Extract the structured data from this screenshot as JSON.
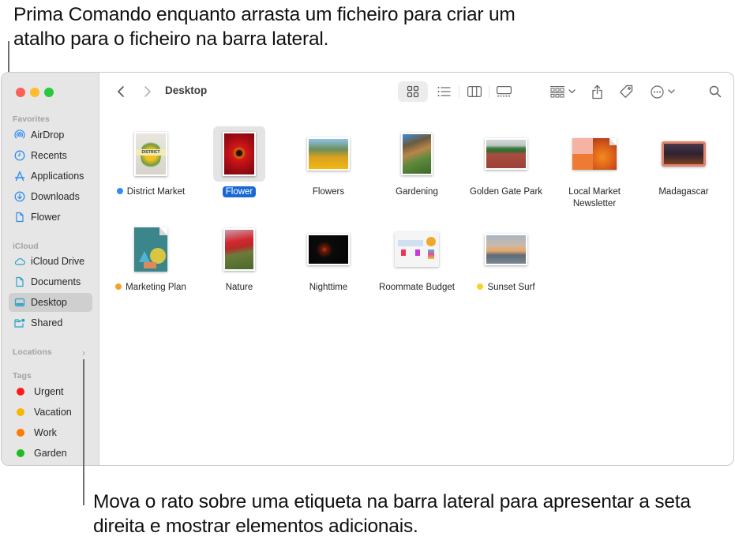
{
  "callouts": {
    "top": "Prima Comando enquanto arrasta um ficheiro para criar um atalho para o ficheiro na barra lateral.",
    "bottom": "Mova o rato sobre uma etiqueta na barra lateral para apresentar a seta direita e mostrar elementos adicionais."
  },
  "window": {
    "title": "Desktop",
    "traffic_lights": [
      "close",
      "minimize",
      "zoom"
    ]
  },
  "sidebar": {
    "favorites_label": "Favorites",
    "favorites": [
      {
        "label": "AirDrop",
        "icon": "airdrop-icon"
      },
      {
        "label": "Recents",
        "icon": "clock-icon"
      },
      {
        "label": "Applications",
        "icon": "applications-icon"
      },
      {
        "label": "Downloads",
        "icon": "download-icon"
      },
      {
        "label": "Flower",
        "icon": "document-icon"
      }
    ],
    "icloud_label": "iCloud",
    "icloud": [
      {
        "label": "iCloud Drive",
        "icon": "cloud-icon"
      },
      {
        "label": "Documents",
        "icon": "document-icon"
      },
      {
        "label": "Desktop",
        "icon": "desktop-icon",
        "selected": true
      },
      {
        "label": "Shared",
        "icon": "shared-folder-icon"
      }
    ],
    "locations_label": "Locations",
    "locations_chevron": "›",
    "tags_label": "Tags",
    "tags": [
      {
        "label": "Urgent",
        "color": "#ff1a1a"
      },
      {
        "label": "Vacation",
        "color": "#f8b500"
      },
      {
        "label": "Work",
        "color": "#ff7a00"
      },
      {
        "label": "Garden",
        "color": "#1ebd1e"
      }
    ]
  },
  "toolbar": {
    "back": "back",
    "forward": "forward",
    "views": [
      "icon-view",
      "list-view",
      "column-view",
      "gallery-view"
    ],
    "active_view": "icon-view",
    "group": "group-by",
    "share": "share",
    "tag": "tags",
    "more": "more-actions",
    "search": "search"
  },
  "files": [
    {
      "name": "District Market",
      "tag_color": "#2f8cf5"
    },
    {
      "name": "Flower",
      "selected": true
    },
    {
      "name": "Flowers"
    },
    {
      "name": "Gardening"
    },
    {
      "name": "Golden Gate Park"
    },
    {
      "name": "Local Market Newsletter"
    },
    {
      "name": "Madagascar"
    },
    {
      "name": "Marketing Plan",
      "tag_color": "#f8a128"
    },
    {
      "name": "Nature"
    },
    {
      "name": "Nighttime"
    },
    {
      "name": "Roommate Budget"
    },
    {
      "name": "Sunset Surf",
      "tag_color": "#f8d12a"
    }
  ],
  "colors": {
    "accent": "#1a68d6",
    "sidebar_bg": "#e6e6e6",
    "icon_blue": "#2f8cf5"
  }
}
